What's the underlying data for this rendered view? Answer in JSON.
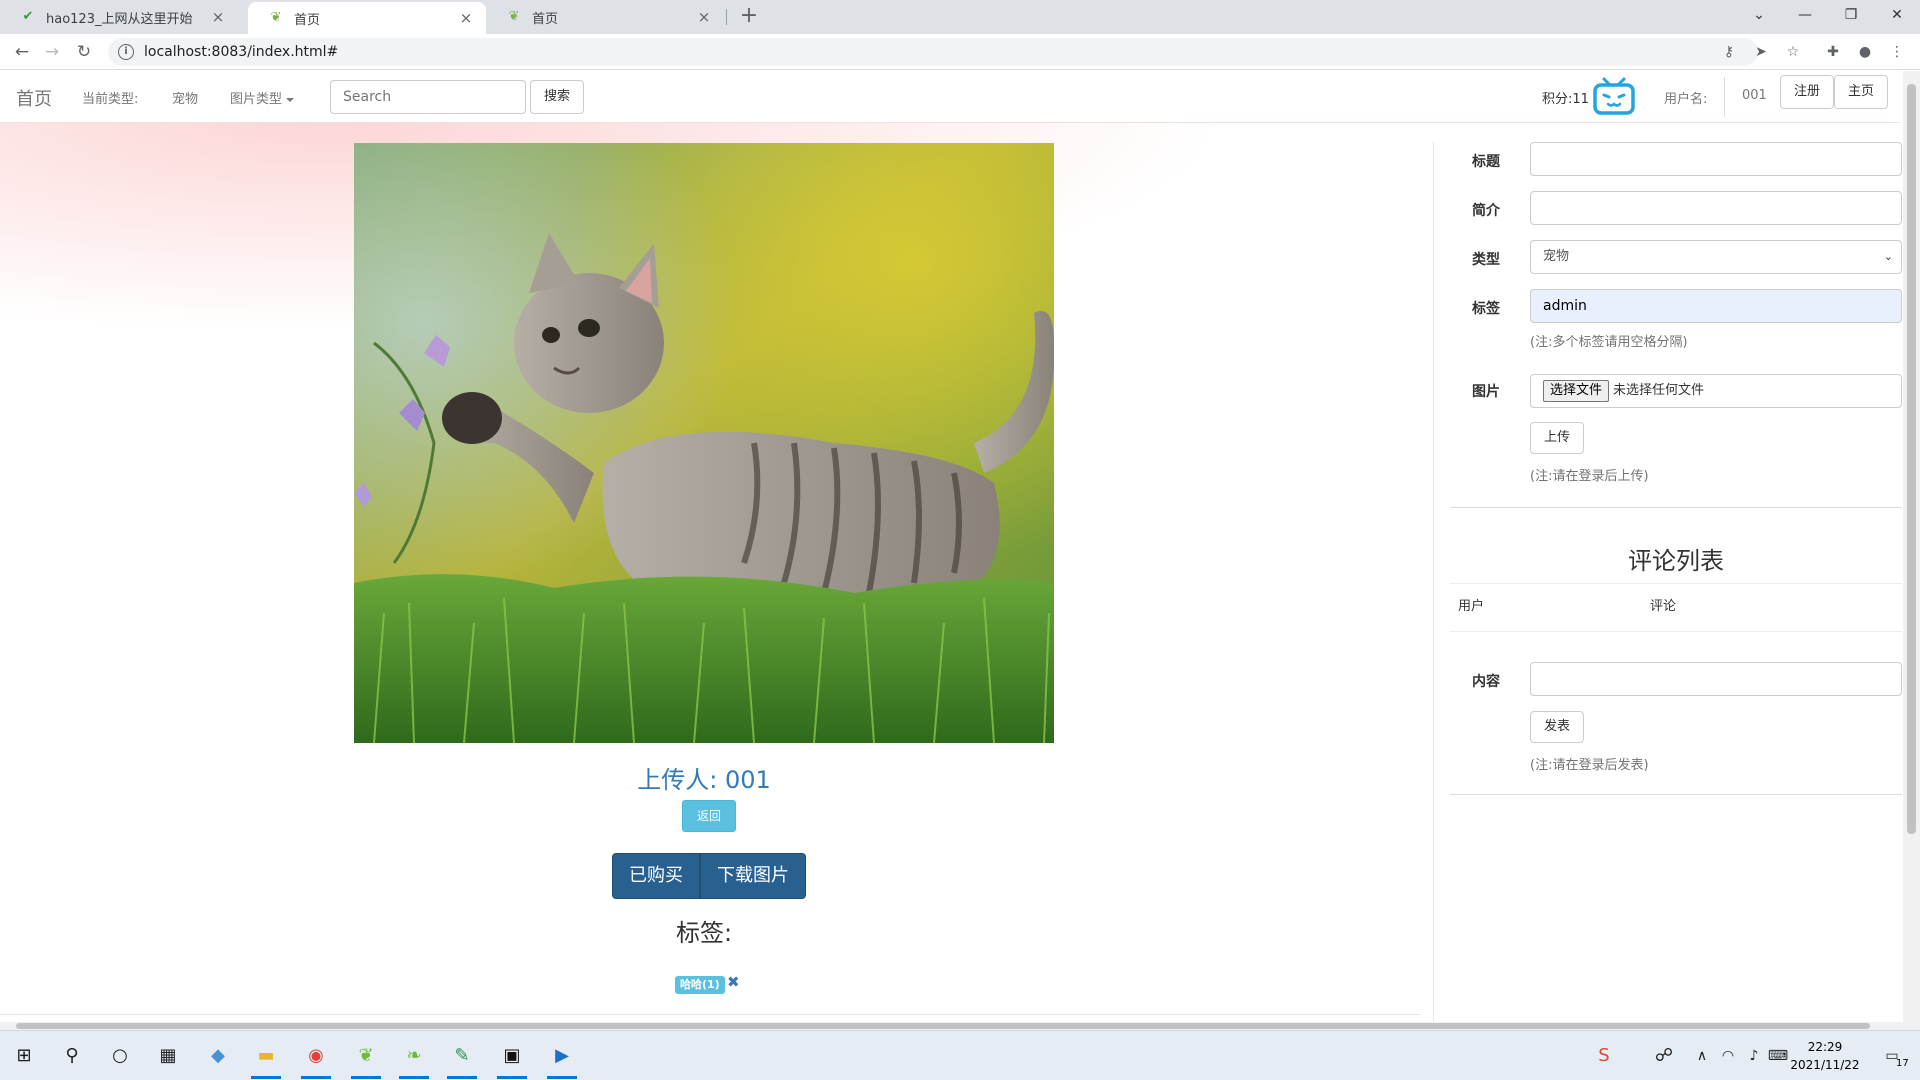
{
  "browser": {
    "tabs": [
      {
        "title": "hao123_上网从这里开始",
        "active": false
      },
      {
        "title": "首页",
        "active": true
      },
      {
        "title": "首页",
        "active": false
      }
    ],
    "new_tab": "+",
    "url": "localhost:8083/index.html#"
  },
  "navbar": {
    "brand": "首页",
    "current_type_label": "当前类型:",
    "current_type_value": "宠物",
    "image_type_dropdown": "图片类型",
    "search_placeholder": "Search",
    "search_button": "搜索",
    "points": "积分:11",
    "username_label": "用户名:",
    "username_value": "001",
    "register_button": "注册",
    "home_button": "主页"
  },
  "main": {
    "uploader_text": "上传人: 001",
    "back_button": "返回",
    "purchased_button": "已购买",
    "download_button": "下载图片",
    "tags_heading": "标签:",
    "tags": [
      {
        "label": "哈哈(1)",
        "remove": "✖"
      }
    ]
  },
  "upload_form": {
    "title_label": "标题",
    "title_value": "",
    "intro_label": "简介",
    "intro_value": "",
    "type_label": "类型",
    "type_value": "宠物",
    "tags_label": "标签",
    "tags_value": "admin",
    "tags_help": "(注:多个标签请用空格分隔)",
    "image_label": "图片",
    "file_button": "选择文件",
    "file_status": "未选择任何文件",
    "upload_button": "上传",
    "upload_help": "(注:请在登录后上传)"
  },
  "comments": {
    "title": "评论列表",
    "col_user": "用户",
    "col_comment": "评论",
    "content_label": "内容",
    "content_value": "",
    "post_button": "发表",
    "post_help": "(注:请在登录后发表)"
  },
  "taskbar": {
    "time": "22:29",
    "date": "2021/11/22",
    "notification_count": "17"
  }
}
